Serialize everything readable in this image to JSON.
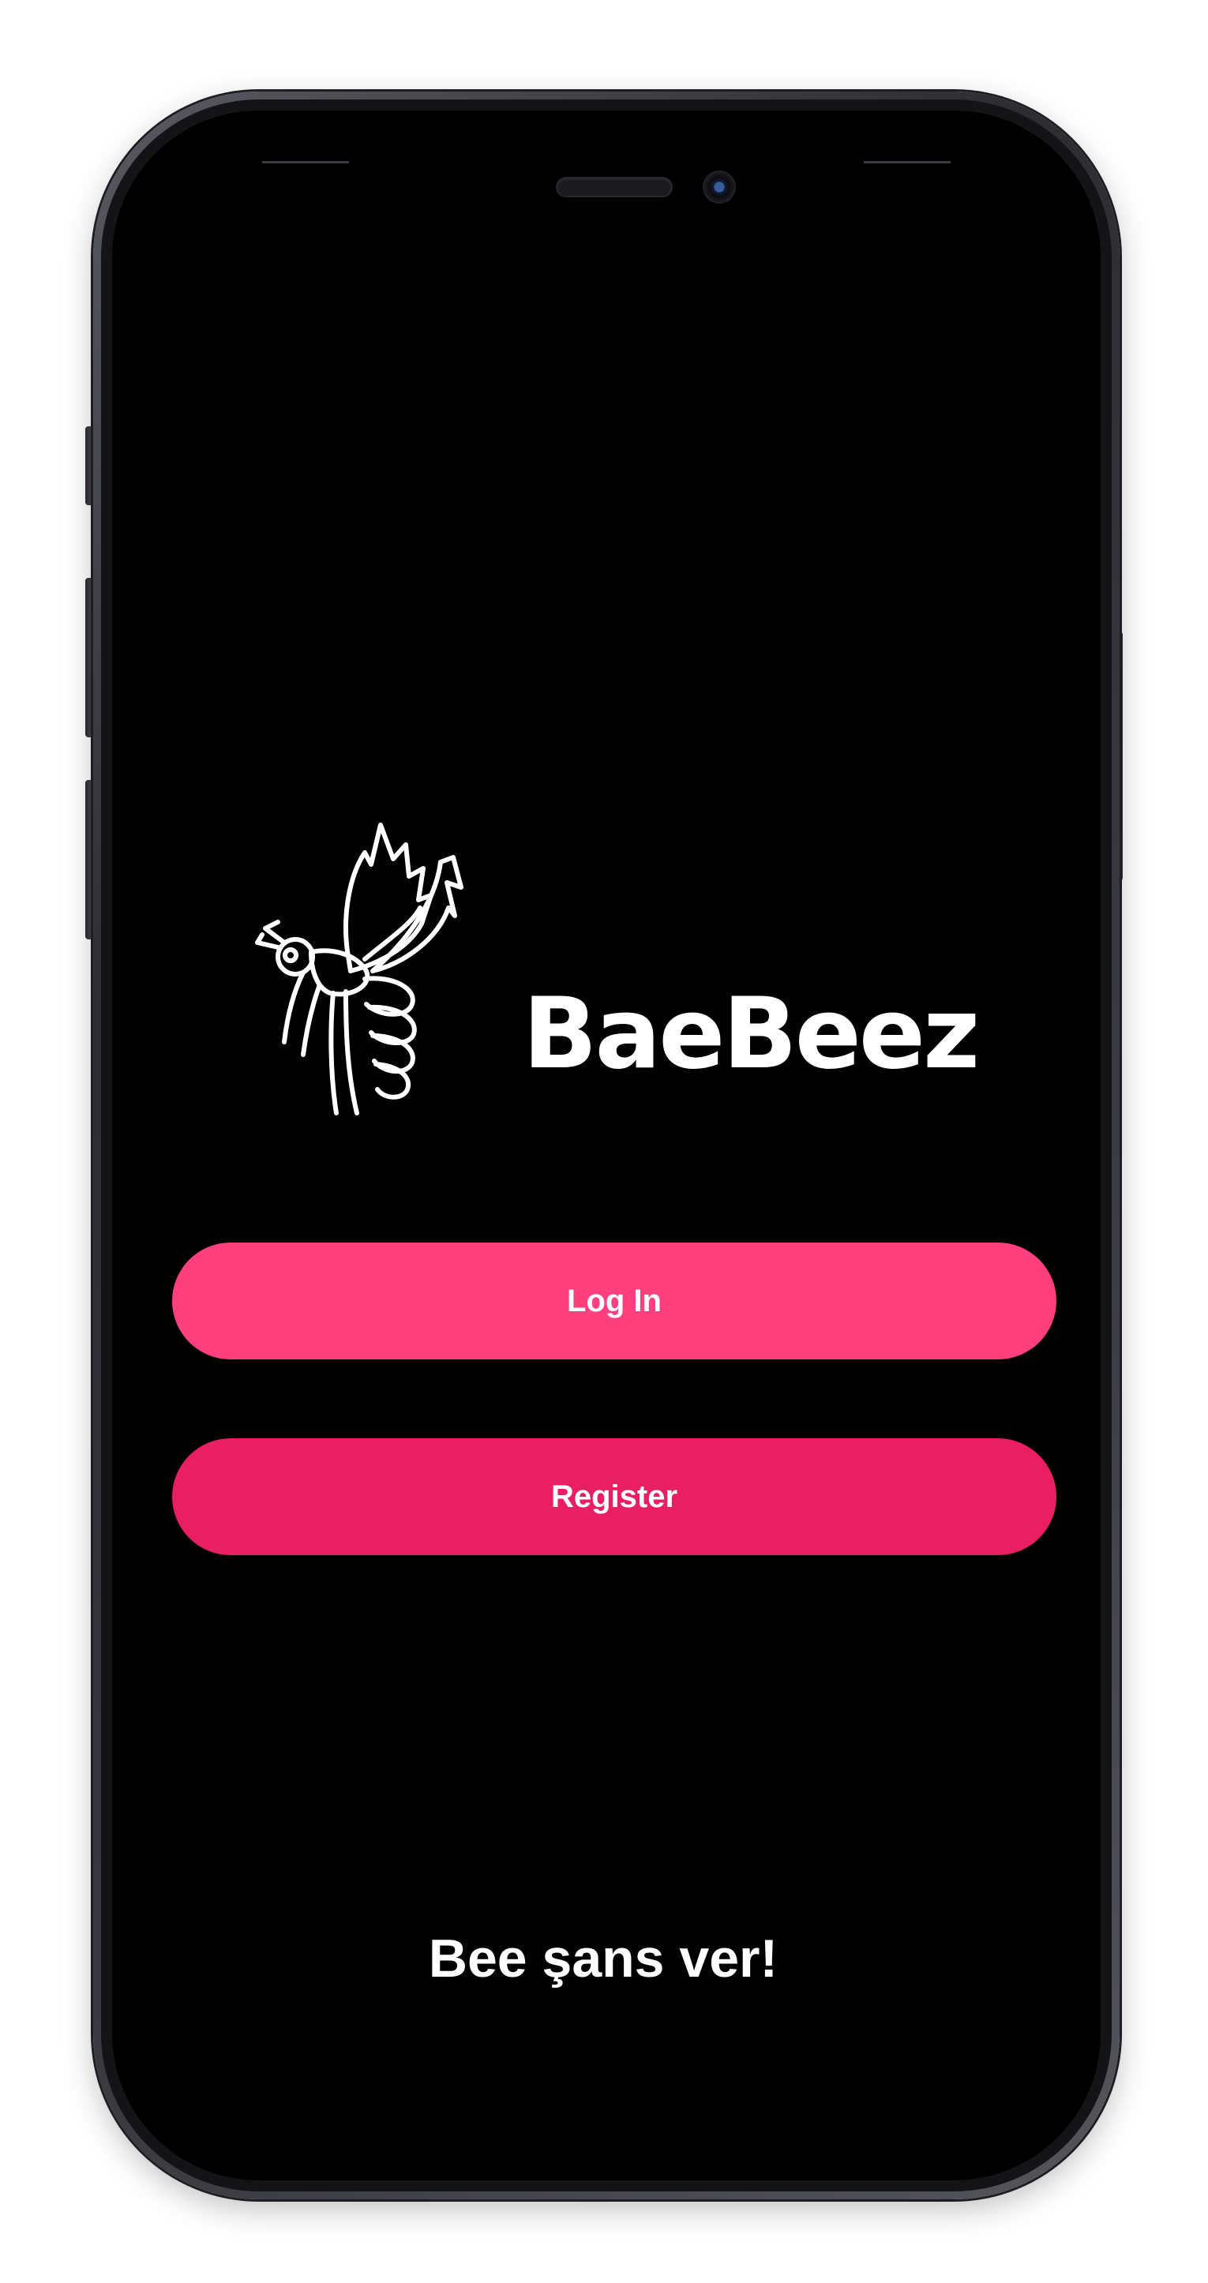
{
  "app": {
    "name": "BaeBeez",
    "logo_icon": "bee-icon"
  },
  "buttons": {
    "login_label": "Log In",
    "register_label": "Register"
  },
  "tagline": "Bee şans ver!",
  "colors": {
    "background": "#000000",
    "login_button": "#FF3F7E",
    "register_button": "#E91E63",
    "text": "#FFFFFF"
  }
}
